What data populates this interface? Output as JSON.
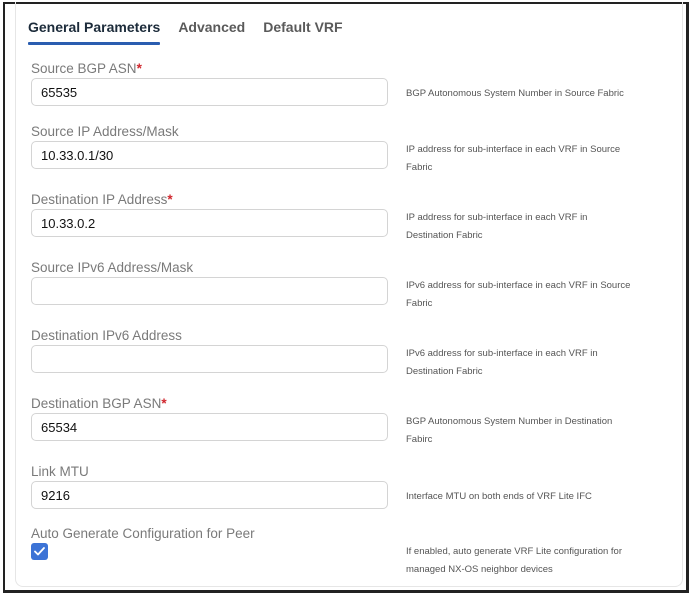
{
  "tabs": [
    {
      "label": "General Parameters",
      "active": true
    },
    {
      "label": "Advanced",
      "active": false
    },
    {
      "label": "Default VRF",
      "active": false
    }
  ],
  "fields": [
    {
      "label": "Source BGP ASN",
      "required": "*",
      "value": "65535",
      "placeholder": "",
      "description": "BGP Autonomous System Number in Source Fabric"
    },
    {
      "label": "Source IP Address/Mask",
      "required": "",
      "value": "10.33.0.1/30",
      "placeholder": "",
      "description": "IP address for sub-interface in each VRF in Source Fabric"
    },
    {
      "label": "Destination IP Address",
      "required": "*",
      "value": "10.33.0.2",
      "placeholder": "",
      "description": "IP address for sub-interface in each VRF in Destination Fabric"
    },
    {
      "label": "Source IPv6 Address/Mask",
      "required": "",
      "value": "",
      "placeholder": "",
      "description": "IPv6 address for sub-interface in each VRF in Source Fabric"
    },
    {
      "label": "Destination IPv6 Address",
      "required": "",
      "value": "",
      "placeholder": "",
      "description": "IPv6 address for sub-interface in each VRF in Destination Fabric"
    },
    {
      "label": "Destination BGP ASN",
      "required": "*",
      "value": "65534",
      "placeholder": "",
      "description": "BGP Autonomous System Number in Destination Fabirc"
    },
    {
      "label": "Link MTU",
      "required": "",
      "value": "9216",
      "placeholder": "",
      "description": "Interface MTU on both ends of VRF Lite IFC"
    }
  ],
  "auto_generate": {
    "label": "Auto Generate Configuration for Peer",
    "checked": true,
    "description": "If enabled, auto generate VRF Lite configuration for managed NX-OS neighbor devices"
  },
  "colors": {
    "accent": "#2a5db0",
    "checkbox": "#3c73d6",
    "required": "#d0262d"
  }
}
